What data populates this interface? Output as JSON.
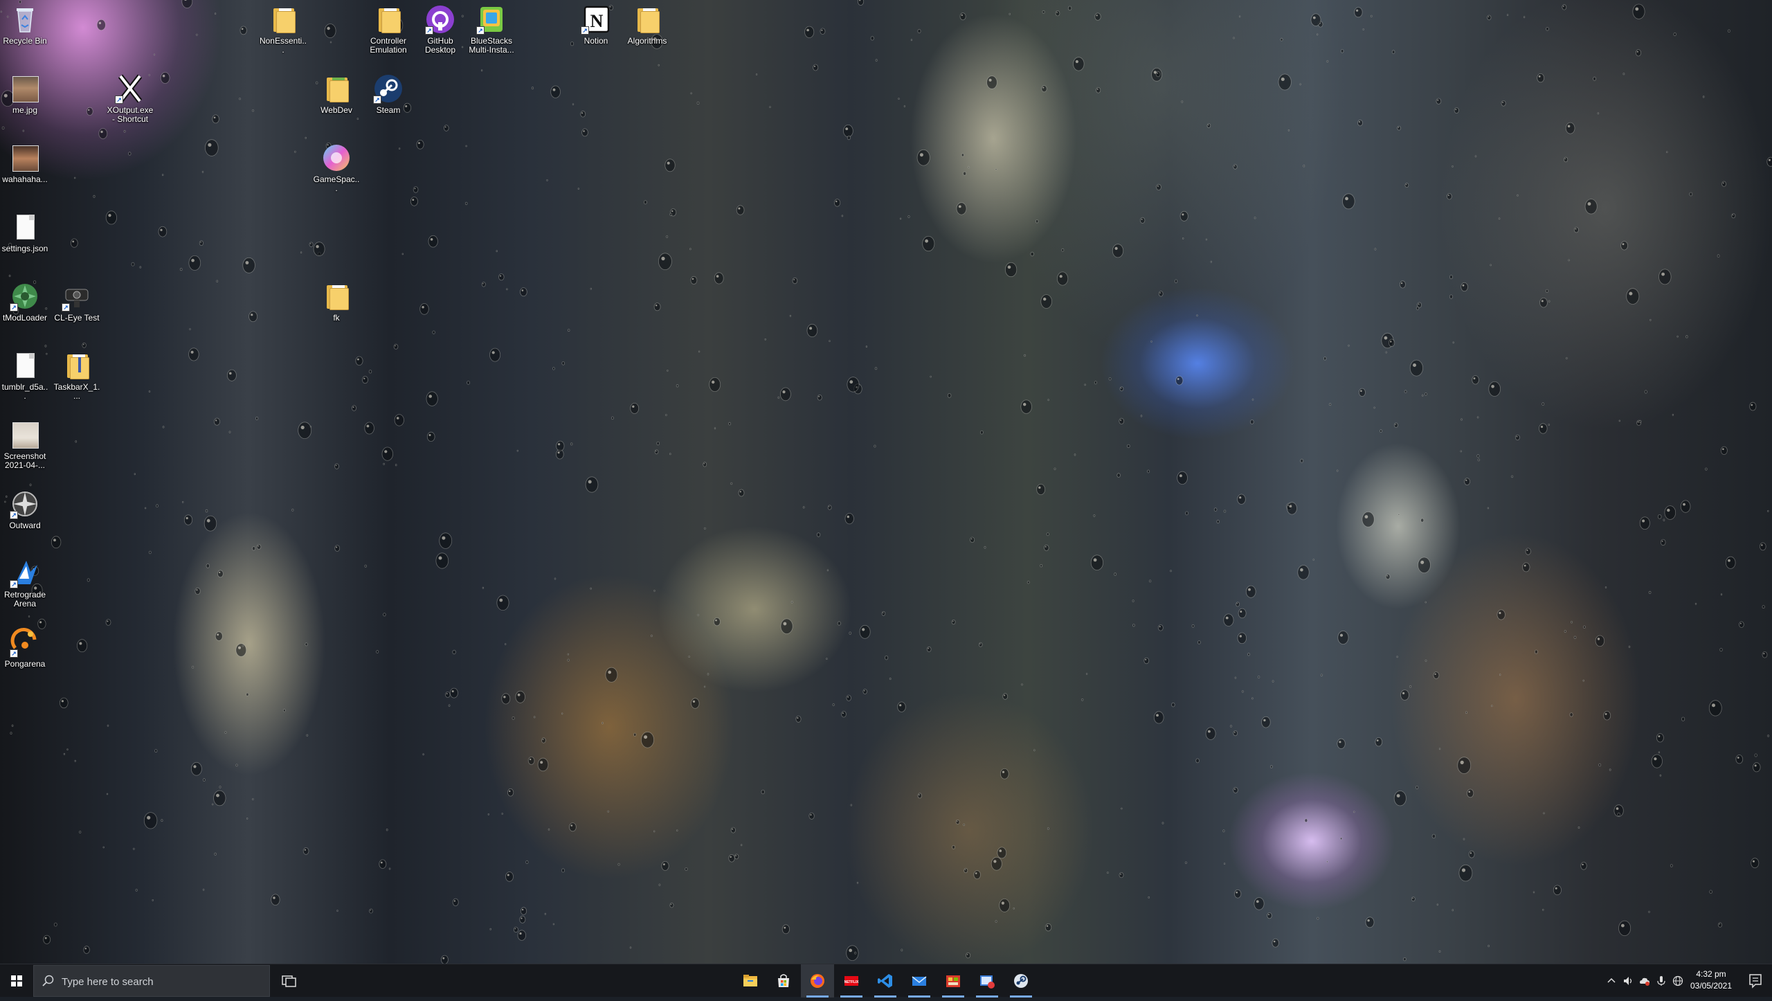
{
  "desktop": {
    "icons": [
      {
        "id": "recycle-bin",
        "label": "Recycle Bin"
      },
      {
        "id": "nonessentials",
        "label": "NonEssenti..."
      },
      {
        "id": "controller-emulation",
        "label": "Controller Emulation"
      },
      {
        "id": "github-desktop",
        "label": "GitHub Desktop"
      },
      {
        "id": "bluestacks",
        "label": "BlueStacks Multi-Insta..."
      },
      {
        "id": "notion",
        "label": "Notion"
      },
      {
        "id": "algorithms",
        "label": "Algorithms"
      },
      {
        "id": "me-jpg",
        "label": "me.jpg"
      },
      {
        "id": "xoutput",
        "label": "XOutput.exe - Shortcut"
      },
      {
        "id": "webdev",
        "label": "WebDev"
      },
      {
        "id": "steam",
        "label": "Steam"
      },
      {
        "id": "wahahaha",
        "label": "wahahaha..."
      },
      {
        "id": "gamespace",
        "label": "GameSpac..."
      },
      {
        "id": "settings-json",
        "label": "settings.json"
      },
      {
        "id": "tmodloader",
        "label": "tModLoader"
      },
      {
        "id": "cl-eye-test",
        "label": "CL-Eye Test"
      },
      {
        "id": "fk",
        "label": "fk"
      },
      {
        "id": "tumblr",
        "label": "tumblr_d5a..."
      },
      {
        "id": "taskbarx",
        "label": "TaskbarX_1...."
      },
      {
        "id": "screenshot",
        "label": "Screenshot 2021-04-..."
      },
      {
        "id": "outward",
        "label": "Outward"
      },
      {
        "id": "retrograde-arena",
        "label": "Retrograde Arena"
      },
      {
        "id": "pongarena",
        "label": "Pongarena"
      }
    ]
  },
  "taskbar": {
    "search_placeholder": "Type here to search",
    "pinned": [
      {
        "name": "File Explorer",
        "icon": "folder-icon"
      },
      {
        "name": "Microsoft Store",
        "icon": "store-icon"
      },
      {
        "name": "Firefox",
        "icon": "firefox-icon"
      },
      {
        "name": "Netflix",
        "icon": "netflix-icon"
      },
      {
        "name": "Visual Studio Code",
        "icon": "vscode-icon"
      },
      {
        "name": "Mail",
        "icon": "mail-icon"
      },
      {
        "name": "Maps",
        "icon": "map-icon"
      },
      {
        "name": "App",
        "icon": "app-icon"
      },
      {
        "name": "Steam",
        "icon": "steam-icon"
      }
    ],
    "clock": {
      "time": "4:32 pm",
      "date": "03/05/2021"
    }
  },
  "colors": {
    "taskbar": "#16181c",
    "accent": "#77aaee"
  }
}
